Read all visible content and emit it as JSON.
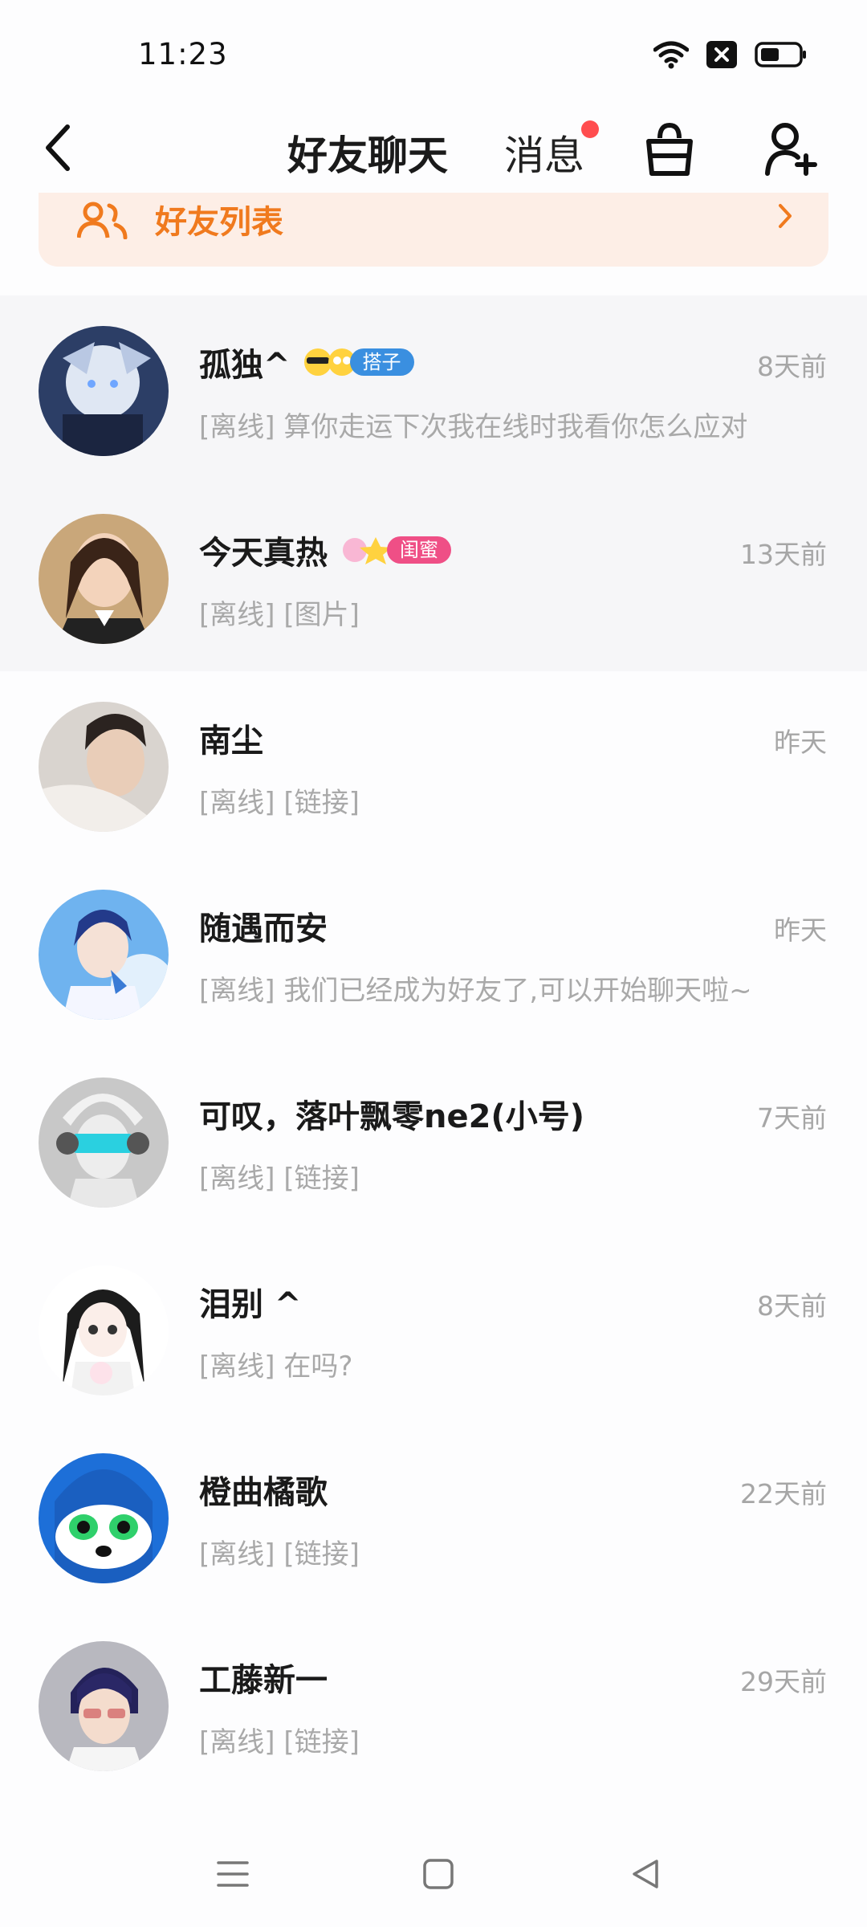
{
  "status": {
    "time": "11:23"
  },
  "header": {
    "tab_friends": "好友聊天",
    "tab_messages": "消息"
  },
  "friend_list_bar": {
    "label": "好友列表"
  },
  "chats": [
    {
      "name": "孤独^",
      "tag": "搭子",
      "tag_color": "#3a8fe0",
      "time": "8天前",
      "preview": "[离线] 算你走运下次我在线时我看你怎么应对",
      "pinned": true
    },
    {
      "name": "今天真热",
      "tag": "闺蜜",
      "tag_color": "#ef4f86",
      "time": "13天前",
      "preview": "[离线] [图片]",
      "pinned": true
    },
    {
      "name": "南尘",
      "time": "昨天",
      "preview": "[离线] [链接]"
    },
    {
      "name": "随遇而安",
      "time": "昨天",
      "preview": "[离线] 我们已经成为好友了,可以开始聊天啦~"
    },
    {
      "name": "可叹，落叶飘零ne2(小号)",
      "time": "7天前",
      "preview": "[离线] [链接]"
    },
    {
      "name": "泪别 ^",
      "time": "8天前",
      "preview": "[离线] 在吗?"
    },
    {
      "name": "橙曲橘歌",
      "time": "22天前",
      "preview": "[离线] [链接]"
    },
    {
      "name": "工藤新一",
      "time": "29天前",
      "preview": "[离线] [链接]"
    }
  ],
  "colors": {
    "accent": "#ff6a13",
    "friend_bar_bg": "#fdeee6",
    "friend_bar_text": "#f07a1e",
    "badge_dot": "#ff4d4f"
  }
}
